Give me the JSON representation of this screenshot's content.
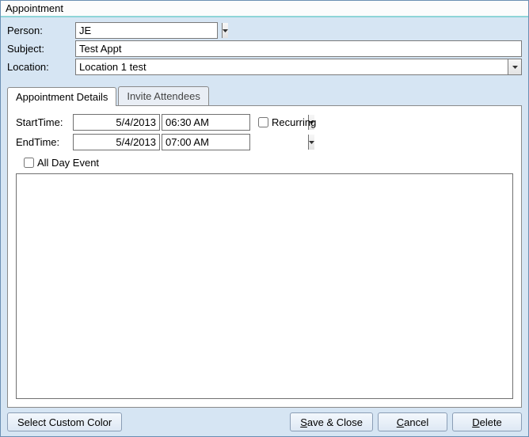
{
  "window": {
    "title": "Appointment"
  },
  "form": {
    "person_label": "Person:",
    "person_value": "JE",
    "subject_label": "Subject:",
    "subject_value": "Test Appt",
    "location_label": "Location:",
    "location_value": "Location 1 test"
  },
  "tabs": {
    "details": "Appointment Details",
    "attendees": "Invite Attendees"
  },
  "details": {
    "start_label": "StartTime:",
    "start_date": "5/4/2013",
    "start_time": "06:30 AM",
    "end_label": "EndTime:",
    "end_date": "5/4/2013",
    "end_time": "07:00 AM",
    "recurring_label": "Recurring",
    "recurring_checked": false,
    "allday_label": "All Day Event",
    "allday_checked": false,
    "notes": ""
  },
  "footer": {
    "custom_color": "Select Custom Color",
    "save_close_pre": "S",
    "save_close_post": "ave & Close",
    "cancel_pre": "C",
    "cancel_post": "ancel",
    "delete_pre": "D",
    "delete_post": "elete"
  }
}
